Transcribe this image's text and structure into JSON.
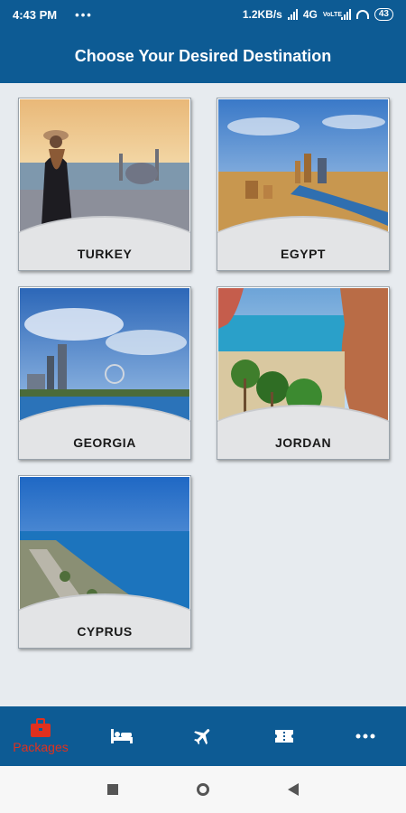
{
  "status": {
    "time": "4:43 PM",
    "speed": "1.2KB/s",
    "network": "4G",
    "volte": "VoLTE",
    "battery": "43"
  },
  "header": {
    "title": "Choose Your Desired Destination"
  },
  "destinations": [
    {
      "label": "TURKEY"
    },
    {
      "label": "EGYPT"
    },
    {
      "label": "GEORGIA"
    },
    {
      "label": "JORDAN"
    },
    {
      "label": "CYPRUS"
    }
  ],
  "nav": {
    "active_label": "Packages",
    "active_color": "#e0301e",
    "icons": [
      "briefcase-icon",
      "bed-icon",
      "airplane-icon",
      "ticket-icon",
      "more-icon"
    ]
  },
  "colors": {
    "primary": "#0d5b94",
    "background": "#e7ebef"
  }
}
